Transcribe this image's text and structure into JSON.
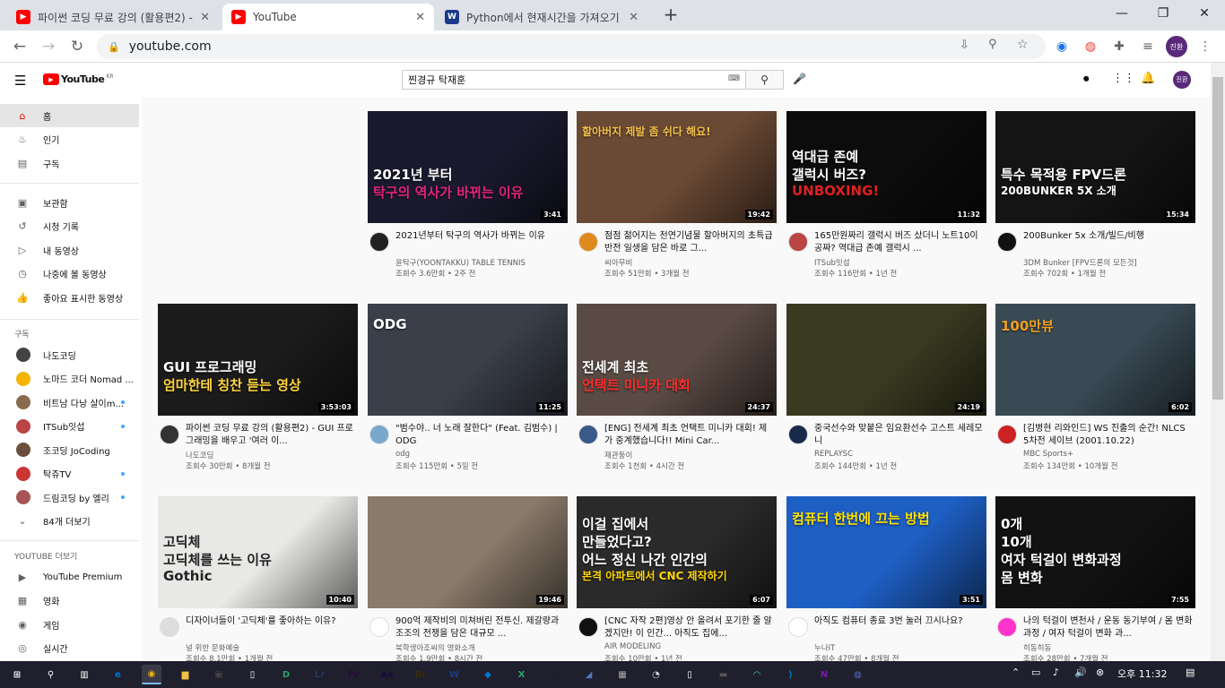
{
  "browser": {
    "tabs": [
      {
        "title": "파이썬 코딩 무료 강의 (활용편2) -",
        "icon": "youtube-favicon",
        "color": "#ff0000"
      },
      {
        "title": "YouTube",
        "icon": "youtube-favicon",
        "color": "#ff0000"
      },
      {
        "title": "Python에서 현재시간을 가져오기",
        "icon": "wf-favicon",
        "color": "#1a3a8a"
      }
    ],
    "new_tab": "+",
    "url": "youtube.com",
    "profile_initial": "진환"
  },
  "youtube": {
    "logo_text": "YouTube",
    "region": "KR",
    "search_value": "찐경규 탁재훈",
    "avatar_initial": "진환"
  },
  "sidebar": {
    "main": [
      {
        "label": "홈",
        "icon": "home-icon",
        "glyph": "⌂"
      },
      {
        "label": "인기",
        "icon": "trending-icon",
        "glyph": "♨"
      },
      {
        "label": "구독",
        "icon": "subscriptions-icon",
        "glyph": "▤"
      }
    ],
    "library": [
      {
        "label": "보관함",
        "icon": "library-icon",
        "glyph": "▣"
      },
      {
        "label": "시청 기록",
        "icon": "history-icon",
        "glyph": "↺"
      },
      {
        "label": "내 동영상",
        "icon": "my-videos-icon",
        "glyph": "▷"
      },
      {
        "label": "나중에 볼 동영상",
        "icon": "watch-later-icon",
        "glyph": "◷"
      },
      {
        "label": "좋아요 표시한 동영상",
        "icon": "liked-icon",
        "glyph": "👍"
      }
    ],
    "subs_heading": "구독",
    "subs": [
      {
        "label": "나도코딩",
        "color": "#444"
      },
      {
        "label": "노마드 코더 Nomad ...",
        "color": "#f5b400"
      },
      {
        "label": "비트남 다낭 살이m...",
        "color": "#8a6b4e"
      },
      {
        "label": "ITSub잇섭",
        "color": "#b44"
      },
      {
        "label": "조코딩 JoCoding",
        "color": "#6a4f3c"
      },
      {
        "label": "탁쥬TV",
        "color": "#c33"
      },
      {
        "label": "드림코딩 by 엘리",
        "color": "#a55"
      }
    ],
    "more": "84개 더보기",
    "more_heading": "YOUTUBE 더보기",
    "extras": [
      {
        "label": "YouTube Premium",
        "icon": "premium-icon",
        "glyph": "▶"
      },
      {
        "label": "영화",
        "icon": "movies-icon",
        "glyph": "▦"
      },
      {
        "label": "게임",
        "icon": "gaming-icon",
        "glyph": "◉"
      },
      {
        "label": "실시간",
        "icon": "live-icon",
        "glyph": "◎"
      }
    ]
  },
  "videos": [
    {
      "title": "2021년부터 탁구의 역사가 바뀌는 이유",
      "channel": "윤탁구(YOONTAKKU) TABLE TENNIS",
      "stats": "조회수 3.6만회 • 2주 전",
      "duration": "3:41",
      "thumb_text": "2021년 부터|탁구의 역사가 바뀌는 이유",
      "bg": "#1a1a2e",
      "accent": "#e0247a",
      "av": "#222"
    },
    {
      "title": "점점 젊어지는 천연기념물 할아버지의 초특급 반전 일생을 담은 바로 그...",
      "channel": "씨아무비",
      "stats": "조회수 51만회 • 3개월 전",
      "duration": "19:42",
      "thumb_text": "할아버지 제발 좀 쉬다 해요!",
      "bg": "#6b4a35",
      "accent": "#f4c24a",
      "av": "#e08a1e"
    },
    {
      "title": "165만원짜리 갤럭시 버즈 샀더니 노트10이 공짜? 역대급 존예 갤럭시 ...",
      "channel": "ITSub잇섭",
      "stats": "조회수 116만회 • 1년 전",
      "duration": "11:32",
      "thumb_text": "역대급 존예|갤럭시 버즈?|UNBOXING!",
      "bg": "#0c0c0c",
      "accent": "#e02020",
      "av": "#b44"
    },
    {
      "title": "200Bunker 5x 소개/빌드/비행",
      "channel": "3DM Bunker [FPV드론의 모든것]",
      "stats": "조회수 702회 • 1개월 전",
      "duration": "15:34",
      "thumb_text": "특수 목적용 FPV드론|200BUNKER 5X 소개",
      "bg": "#141414",
      "accent": "#ffffff",
      "av": "#111"
    },
    {
      "title": "파이썬 코딩 무료 강의 (활용편2) - GUI 프로그래밍을 배우고 '여러 이...",
      "channel": "나도코딩",
      "stats": "조회수 30만회 • 8개월 전",
      "duration": "3:53:03",
      "thumb_text": "GUI 프로그래밍|엄마한테 칭찬 듣는 영상",
      "bg": "#1b1b1b",
      "accent": "#ffd43b",
      "av": "#333"
    },
    {
      "title": "\"범수야.. 너 노래 잘한다\" (Feat. 김범수) | ODG",
      "channel": "odg",
      "stats": "조회수 115만회 • 5일 전",
      "duration": "11:25",
      "thumb_text": "ODG",
      "bg": "#3a3f4a",
      "accent": "#ffffff",
      "av": "#7aa7cc"
    },
    {
      "title": "[ENG] 전세계 최초 언택트 미니카 대회! 제가 중계했습니다!! Mini Car...",
      "channel": "재관둥이",
      "stats": "조회수 1천회 • 4시간 전",
      "duration": "24:37",
      "thumb_text": "전세계 최초|언택트 미니카 대회",
      "bg": "#5a4a44",
      "accent": "#ff2d2d",
      "av": "#3a5a8a"
    },
    {
      "title": "중국선수와 맞붙은 임요환선수 고스트 세레모니",
      "channel": "REPLAYSC",
      "stats": "조회수 144만회 • 1년 전",
      "duration": "24:19",
      "thumb_text": "",
      "bg": "#3a3a22",
      "accent": "#88aa55",
      "av": "#1a2a4a"
    },
    {
      "title": "[김병현 리와인드] WS 진출의 순간! NLCS 5차전 세이브 (2001.10.22)",
      "channel": "MBC Sports+",
      "stats": "조회수 134만회 • 10개월 전",
      "duration": "6:02",
      "thumb_text": "100만뷰",
      "bg": "#3a4a55",
      "accent": "#f0a020",
      "av": "#c22"
    },
    {
      "title": "디자이너들이 '고딕체'를 좋아하는 이유?",
      "channel": "널 위한 문화예술",
      "stats": "조회수 8.1만회 • 1개월 전",
      "duration": "10:40",
      "thumb_text": "고딕체|고딕체를 쓰는 이유|Gothic",
      "bg": "#e8e8e6",
      "accent": "#222222",
      "av": "#ddd"
    },
    {
      "title": "900억 제작비의 미쳐버린 전투신. 제갈량과 조조의 전쟁을 담은 대규모 ...",
      "channel": "북학생아조씨의 영화소개",
      "stats": "조회수 1.9만회 • 8시간 전",
      "duration": "19:46",
      "thumb_text": "",
      "bg": "#8a7a6a",
      "accent": "#dddddd",
      "av": "#fff"
    },
    {
      "title": "[CNC 자작 2편]영상 안 올려서 포기한 줄 알겠지만! 이 인간... 아직도 집에...",
      "channel": "AIR MODELING",
      "stats": "조회수 10만회 • 1년 전",
      "duration": "6:07",
      "thumb_text": "이걸 집에서|만들었다고?|어느 정신 나간 인간의|본격 아파트에서 CNC 제작하기",
      "bg": "#2a2a2a",
      "accent": "#ffd700",
      "av": "#111"
    },
    {
      "title": "아직도 컴퓨터 종료 3번 눌러 끄시나요?",
      "channel": "누나IT",
      "stats": "조회수 47만회 • 8개월 전",
      "duration": "3:51",
      "thumb_text": "컴퓨터 한번에 끄는 방법",
      "bg": "#1e5fc4",
      "accent": "#ffe400",
      "av": "#fff"
    },
    {
      "title": "나의 턱걸이 변천사 / 운동 동기부여 / 몸 변화 과정 / 여자 턱걸이 변화 과...",
      "channel": "히동히동",
      "stats": "조회수 28만회 • 7개월 전",
      "duration": "7:55",
      "thumb_text": "0개|10개|여자 턱걸이 변화과정|몸 변화",
      "bg": "#121212",
      "accent": "#ffffff",
      "av": "#f3c"
    }
  ],
  "taskbar": {
    "time": "오후 11:32",
    "apps": [
      "start-icon",
      "search-icon",
      "taskview-icon",
      "edge-icon",
      "chrome-icon",
      "explorer-icon",
      "store-icon",
      "file-icon",
      "excel-icon",
      "lightroom-icon",
      "premiere-icon",
      "aftereffects-icon",
      "bridge-icon",
      "wf-icon",
      "box-icon",
      "excel2-icon",
      "cmd-icon",
      "app-icon",
      "app2-icon",
      "app3-icon",
      "file2-icon",
      "app4-icon",
      "android-icon",
      "vscode-icon",
      "onenote-icon",
      "app5-icon"
    ]
  }
}
